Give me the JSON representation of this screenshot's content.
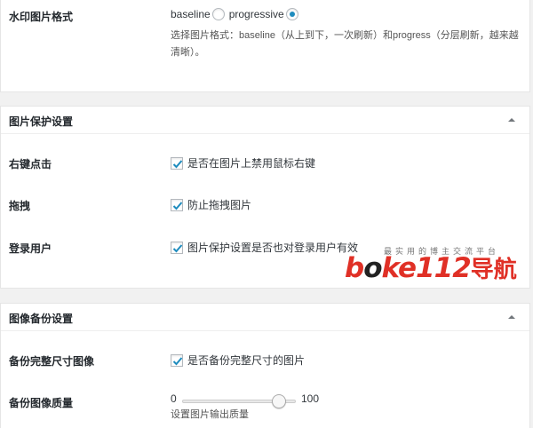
{
  "format_section": {
    "label": "水印图片格式",
    "options": [
      {
        "label": "baseline",
        "checked": false
      },
      {
        "label": "progressive",
        "checked": true
      }
    ],
    "description": "选择图片格式：baseline（从上到下，一次刷新）和progress（分层刷新，越来越清晰）。"
  },
  "protect_section": {
    "title": "图片保护设置",
    "rows": [
      {
        "label": "右键点击",
        "checkbox": "是否在图片上禁用鼠标右键",
        "checked": true
      },
      {
        "label": "拖拽",
        "checkbox": "防止拖拽图片",
        "checked": true
      },
      {
        "label": "登录用户",
        "checkbox": "图片保护设置是否也对登录用户有效",
        "checked": true
      }
    ]
  },
  "backup_section": {
    "title": "图像备份设置",
    "full_size": {
      "label": "备份完整尺寸图像",
      "checkbox": "是否备份完整尺寸的图片",
      "checked": true
    },
    "quality": {
      "label": "备份图像质量",
      "min": "0",
      "max": "100",
      "value": 90,
      "description": "设置图片输出质量"
    }
  },
  "watermark": {
    "slogan": "最实用的博主交流平台",
    "brand_red_1": "b",
    "brand_dark": "o",
    "brand_red_2": "ke112",
    "brand_nav": "导航"
  },
  "colors": {
    "accent": "#1e8cbe",
    "watermark": "#e03026"
  }
}
